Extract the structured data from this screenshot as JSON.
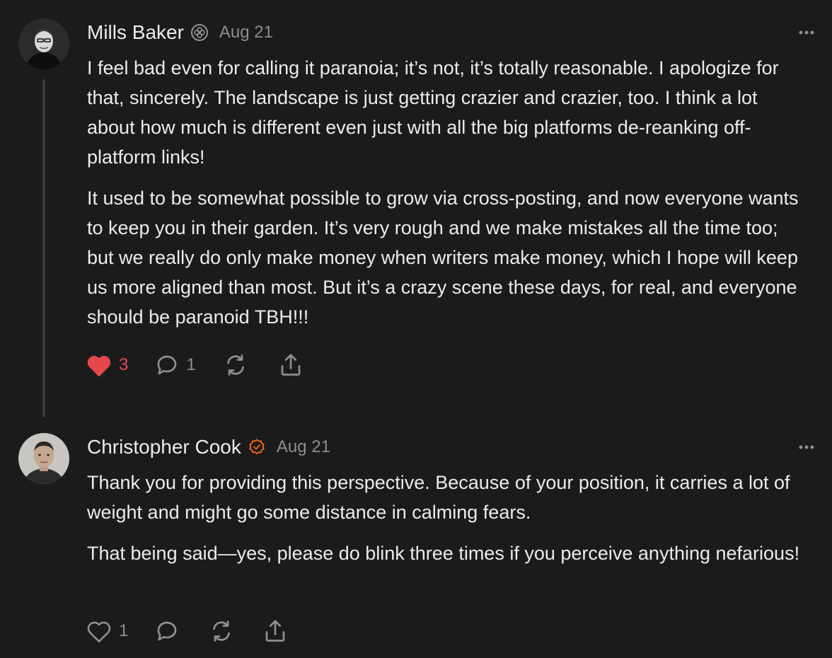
{
  "comments": [
    {
      "author": "Mills Baker",
      "date": "Aug 21",
      "paragraphs": [
        "I feel bad even for calling it paranoia; it’s not, it’s totally reasonable. I apologize for that, sincerely. The landscape is just getting crazier and crazier, too. I think a lot about how much is different even just with all the big platforms de-reanking off-platform links!",
        "It used to be somewhat possible to grow via cross-posting, and now everyone wants to keep you in their garden. It’s very rough and we make mistakes all the time too; but we really do only make money when writers make money, which I hope will keep us more aligned than most. But it’s a crazy scene these days, for real, and everyone should be paranoid TBH!!!"
      ],
      "likes": "3",
      "liked": true,
      "replies": "1",
      "badge_icon": "substack-staff-badge-icon",
      "colors": {
        "like": "#e5484d"
      }
    },
    {
      "author": "Christopher Cook",
      "date": "Aug 21",
      "paragraphs": [
        "Thank you for providing this perspective. Because of your position, it carries a lot of weight and might go some distance in calming fears.",
        "That being said—yes, please do blink three times if you perceive anything nefarious!"
      ],
      "likes": "1",
      "liked": false,
      "replies": "",
      "badge_icon": "verified-check-badge-icon",
      "colors": {
        "badge": "#ff6719"
      }
    }
  ]
}
